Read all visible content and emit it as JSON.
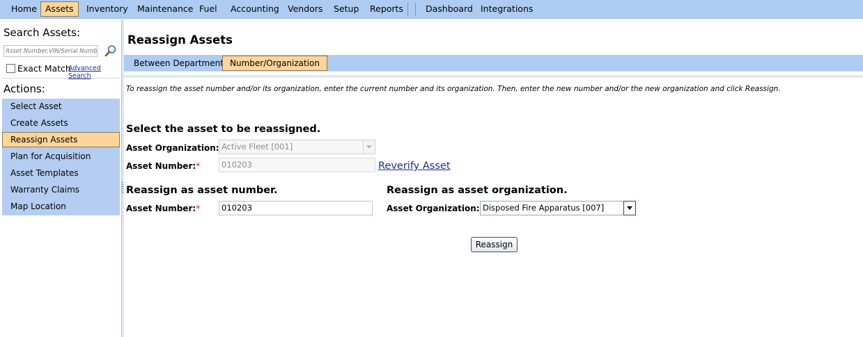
{
  "topnav": {
    "items": [
      {
        "label": "Home"
      },
      {
        "label": "Assets"
      },
      {
        "label": "Inventory"
      },
      {
        "label": "Maintenance"
      },
      {
        "label": "Fuel"
      },
      {
        "label": "Accounting"
      },
      {
        "label": "Vendors"
      },
      {
        "label": "Setup"
      },
      {
        "label": "Reports"
      },
      {
        "label": "Dashboard"
      },
      {
        "label": "Integrations"
      }
    ],
    "active": "Assets"
  },
  "sidebar": {
    "search_title": "Search Assets:",
    "search_placeholder": "Asset Number,VIN/Serial Number",
    "exact_match_label": "Exact Match",
    "advanced_search_label": "Advanced Search",
    "actions_title": "Actions:",
    "actions": [
      {
        "label": "Select Asset"
      },
      {
        "label": "Create Assets"
      },
      {
        "label": "Reassign Assets"
      },
      {
        "label": "Plan for Acquisition"
      },
      {
        "label": "Asset Templates"
      },
      {
        "label": "Warranty Claims"
      },
      {
        "label": "Map Location"
      }
    ],
    "active_action": "Reassign Assets"
  },
  "main": {
    "title": "Reassign Assets",
    "tabs": [
      {
        "label": "Between Departments"
      },
      {
        "label": "Number/Organization"
      }
    ],
    "active_tab": "Number/Organization",
    "instructions": "To reassign the asset number and/or its organization, enter the current number and its organization. Then, enter the new number and/or the new organization and click Reassign.",
    "current": {
      "heading": "Select the asset to be reassigned.",
      "org_label": "Asset Organization:",
      "org_value": "Active Fleet [001]",
      "number_label": "Asset Number",
      "number_value": "010203",
      "reverify_label": "Reverify Asset"
    },
    "new_number": {
      "heading": "Reassign as asset number.",
      "number_label": "Asset Number",
      "number_value": "010203"
    },
    "new_org": {
      "heading": "Reassign as asset organization.",
      "org_label": "Asset Organization:",
      "org_value": "Disposed Fire Apparatus [007]"
    },
    "reassign_button": "Reassign",
    "required_mark": "*",
    "colon": ":"
  },
  "colors": {
    "nav_bg": "#aecbf2",
    "active_bg": "#fcd59b",
    "actions_bg": "#b4cdf1",
    "link": "#1a2d8a",
    "required": "#dd1111"
  }
}
